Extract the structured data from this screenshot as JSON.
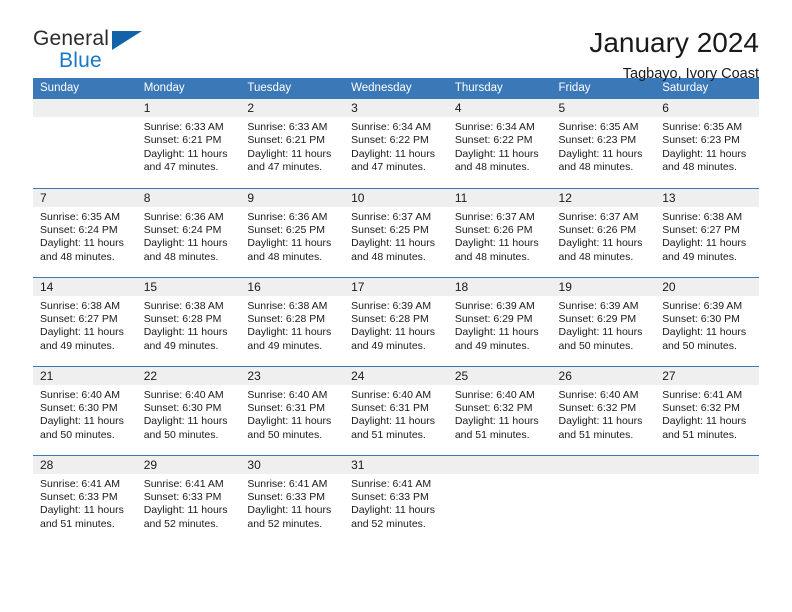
{
  "brand": {
    "name_part1": "General",
    "name_part2": "Blue",
    "accent_color": "#1878c8",
    "triangle_color": "#1263a8",
    "triangle_icon": "triangle-icon"
  },
  "header": {
    "title": "January 2024",
    "subtitle": "Tagbayo, Ivory Coast"
  },
  "theme": {
    "header_bar_color": "#3a78b8",
    "daynum_strip_color": "#efefef",
    "text_color": "#1a1a1a"
  },
  "weekday_headers": [
    "Sunday",
    "Monday",
    "Tuesday",
    "Wednesday",
    "Thursday",
    "Friday",
    "Saturday"
  ],
  "weeks": [
    [
      {
        "day": "",
        "empty": true,
        "sunrise": "",
        "sunset": "",
        "daylight_line1": "",
        "daylight_line2": ""
      },
      {
        "day": "1",
        "empty": false,
        "sunrise": "Sunrise: 6:33 AM",
        "sunset": "Sunset: 6:21 PM",
        "daylight_line1": "Daylight: 11 hours",
        "daylight_line2": "and 47 minutes."
      },
      {
        "day": "2",
        "empty": false,
        "sunrise": "Sunrise: 6:33 AM",
        "sunset": "Sunset: 6:21 PM",
        "daylight_line1": "Daylight: 11 hours",
        "daylight_line2": "and 47 minutes."
      },
      {
        "day": "3",
        "empty": false,
        "sunrise": "Sunrise: 6:34 AM",
        "sunset": "Sunset: 6:22 PM",
        "daylight_line1": "Daylight: 11 hours",
        "daylight_line2": "and 47 minutes."
      },
      {
        "day": "4",
        "empty": false,
        "sunrise": "Sunrise: 6:34 AM",
        "sunset": "Sunset: 6:22 PM",
        "daylight_line1": "Daylight: 11 hours",
        "daylight_line2": "and 48 minutes."
      },
      {
        "day": "5",
        "empty": false,
        "sunrise": "Sunrise: 6:35 AM",
        "sunset": "Sunset: 6:23 PM",
        "daylight_line1": "Daylight: 11 hours",
        "daylight_line2": "and 48 minutes."
      },
      {
        "day": "6",
        "empty": false,
        "sunrise": "Sunrise: 6:35 AM",
        "sunset": "Sunset: 6:23 PM",
        "daylight_line1": "Daylight: 11 hours",
        "daylight_line2": "and 48 minutes."
      }
    ],
    [
      {
        "day": "7",
        "empty": false,
        "sunrise": "Sunrise: 6:35 AM",
        "sunset": "Sunset: 6:24 PM",
        "daylight_line1": "Daylight: 11 hours",
        "daylight_line2": "and 48 minutes."
      },
      {
        "day": "8",
        "empty": false,
        "sunrise": "Sunrise: 6:36 AM",
        "sunset": "Sunset: 6:24 PM",
        "daylight_line1": "Daylight: 11 hours",
        "daylight_line2": "and 48 minutes."
      },
      {
        "day": "9",
        "empty": false,
        "sunrise": "Sunrise: 6:36 AM",
        "sunset": "Sunset: 6:25 PM",
        "daylight_line1": "Daylight: 11 hours",
        "daylight_line2": "and 48 minutes."
      },
      {
        "day": "10",
        "empty": false,
        "sunrise": "Sunrise: 6:37 AM",
        "sunset": "Sunset: 6:25 PM",
        "daylight_line1": "Daylight: 11 hours",
        "daylight_line2": "and 48 minutes."
      },
      {
        "day": "11",
        "empty": false,
        "sunrise": "Sunrise: 6:37 AM",
        "sunset": "Sunset: 6:26 PM",
        "daylight_line1": "Daylight: 11 hours",
        "daylight_line2": "and 48 minutes."
      },
      {
        "day": "12",
        "empty": false,
        "sunrise": "Sunrise: 6:37 AM",
        "sunset": "Sunset: 6:26 PM",
        "daylight_line1": "Daylight: 11 hours",
        "daylight_line2": "and 48 minutes."
      },
      {
        "day": "13",
        "empty": false,
        "sunrise": "Sunrise: 6:38 AM",
        "sunset": "Sunset: 6:27 PM",
        "daylight_line1": "Daylight: 11 hours",
        "daylight_line2": "and 49 minutes."
      }
    ],
    [
      {
        "day": "14",
        "empty": false,
        "sunrise": "Sunrise: 6:38 AM",
        "sunset": "Sunset: 6:27 PM",
        "daylight_line1": "Daylight: 11 hours",
        "daylight_line2": "and 49 minutes."
      },
      {
        "day": "15",
        "empty": false,
        "sunrise": "Sunrise: 6:38 AM",
        "sunset": "Sunset: 6:28 PM",
        "daylight_line1": "Daylight: 11 hours",
        "daylight_line2": "and 49 minutes."
      },
      {
        "day": "16",
        "empty": false,
        "sunrise": "Sunrise: 6:38 AM",
        "sunset": "Sunset: 6:28 PM",
        "daylight_line1": "Daylight: 11 hours",
        "daylight_line2": "and 49 minutes."
      },
      {
        "day": "17",
        "empty": false,
        "sunrise": "Sunrise: 6:39 AM",
        "sunset": "Sunset: 6:28 PM",
        "daylight_line1": "Daylight: 11 hours",
        "daylight_line2": "and 49 minutes."
      },
      {
        "day": "18",
        "empty": false,
        "sunrise": "Sunrise: 6:39 AM",
        "sunset": "Sunset: 6:29 PM",
        "daylight_line1": "Daylight: 11 hours",
        "daylight_line2": "and 49 minutes."
      },
      {
        "day": "19",
        "empty": false,
        "sunrise": "Sunrise: 6:39 AM",
        "sunset": "Sunset: 6:29 PM",
        "daylight_line1": "Daylight: 11 hours",
        "daylight_line2": "and 50 minutes."
      },
      {
        "day": "20",
        "empty": false,
        "sunrise": "Sunrise: 6:39 AM",
        "sunset": "Sunset: 6:30 PM",
        "daylight_line1": "Daylight: 11 hours",
        "daylight_line2": "and 50 minutes."
      }
    ],
    [
      {
        "day": "21",
        "empty": false,
        "sunrise": "Sunrise: 6:40 AM",
        "sunset": "Sunset: 6:30 PM",
        "daylight_line1": "Daylight: 11 hours",
        "daylight_line2": "and 50 minutes."
      },
      {
        "day": "22",
        "empty": false,
        "sunrise": "Sunrise: 6:40 AM",
        "sunset": "Sunset: 6:30 PM",
        "daylight_line1": "Daylight: 11 hours",
        "daylight_line2": "and 50 minutes."
      },
      {
        "day": "23",
        "empty": false,
        "sunrise": "Sunrise: 6:40 AM",
        "sunset": "Sunset: 6:31 PM",
        "daylight_line1": "Daylight: 11 hours",
        "daylight_line2": "and 50 minutes."
      },
      {
        "day": "24",
        "empty": false,
        "sunrise": "Sunrise: 6:40 AM",
        "sunset": "Sunset: 6:31 PM",
        "daylight_line1": "Daylight: 11 hours",
        "daylight_line2": "and 51 minutes."
      },
      {
        "day": "25",
        "empty": false,
        "sunrise": "Sunrise: 6:40 AM",
        "sunset": "Sunset: 6:32 PM",
        "daylight_line1": "Daylight: 11 hours",
        "daylight_line2": "and 51 minutes."
      },
      {
        "day": "26",
        "empty": false,
        "sunrise": "Sunrise: 6:40 AM",
        "sunset": "Sunset: 6:32 PM",
        "daylight_line1": "Daylight: 11 hours",
        "daylight_line2": "and 51 minutes."
      },
      {
        "day": "27",
        "empty": false,
        "sunrise": "Sunrise: 6:41 AM",
        "sunset": "Sunset: 6:32 PM",
        "daylight_line1": "Daylight: 11 hours",
        "daylight_line2": "and 51 minutes."
      }
    ],
    [
      {
        "day": "28",
        "empty": false,
        "sunrise": "Sunrise: 6:41 AM",
        "sunset": "Sunset: 6:33 PM",
        "daylight_line1": "Daylight: 11 hours",
        "daylight_line2": "and 51 minutes."
      },
      {
        "day": "29",
        "empty": false,
        "sunrise": "Sunrise: 6:41 AM",
        "sunset": "Sunset: 6:33 PM",
        "daylight_line1": "Daylight: 11 hours",
        "daylight_line2": "and 52 minutes."
      },
      {
        "day": "30",
        "empty": false,
        "sunrise": "Sunrise: 6:41 AM",
        "sunset": "Sunset: 6:33 PM",
        "daylight_line1": "Daylight: 11 hours",
        "daylight_line2": "and 52 minutes."
      },
      {
        "day": "31",
        "empty": false,
        "sunrise": "Sunrise: 6:41 AM",
        "sunset": "Sunset: 6:33 PM",
        "daylight_line1": "Daylight: 11 hours",
        "daylight_line2": "and 52 minutes."
      },
      {
        "day": "",
        "empty": true,
        "sunrise": "",
        "sunset": "",
        "daylight_line1": "",
        "daylight_line2": ""
      },
      {
        "day": "",
        "empty": true,
        "sunrise": "",
        "sunset": "",
        "daylight_line1": "",
        "daylight_line2": ""
      },
      {
        "day": "",
        "empty": true,
        "sunrise": "",
        "sunset": "",
        "daylight_line1": "",
        "daylight_line2": ""
      }
    ]
  ]
}
